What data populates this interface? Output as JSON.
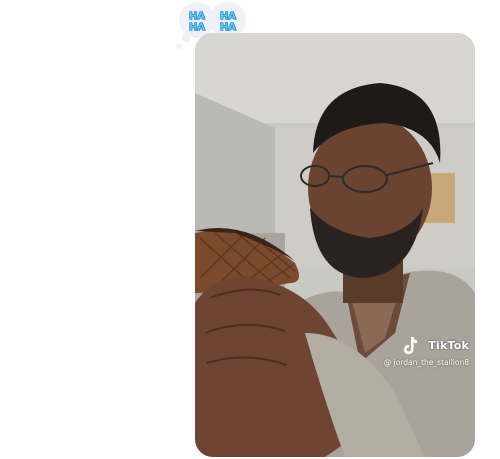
{
  "reaction": {
    "icon": "haha-reaction-icon",
    "label": "HA HA",
    "word": "HA",
    "colors": {
      "bubble": "#eef2f7",
      "text": "#5bc8f5",
      "text_shadow": "#1a73c9"
    }
  },
  "video": {
    "watermark": {
      "brand": "TikTok",
      "handle": "@ jordan_the_stallion8",
      "icon": "tiktok-logo-icon"
    }
  }
}
